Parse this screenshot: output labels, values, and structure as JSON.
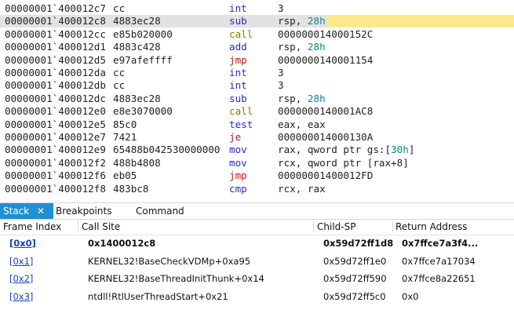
{
  "disassembly": [
    {
      "addr": "00000001`400012c7",
      "bytes": "cc",
      "mnemonic": "int",
      "operand": "3"
    },
    {
      "addr": "00000001`400012c8",
      "bytes": "4883ec28",
      "mnemonic": "sub",
      "operand": "rsp, ",
      "operand_hex": "28h",
      "current": true
    },
    {
      "addr": "00000001`400012cc",
      "bytes": "e85b020000",
      "mnemonic": "call",
      "operand": "000000014000152C"
    },
    {
      "addr": "00000001`400012d1",
      "bytes": "4883c428",
      "mnemonic": "add",
      "operand": "rsp, ",
      "operand_hex": "28h"
    },
    {
      "addr": "00000001`400012d5",
      "bytes": "e97afeffff",
      "mnemonic": "jmp",
      "operand": "0000000140001154"
    },
    {
      "addr": "00000001`400012da",
      "bytes": "cc",
      "mnemonic": "int",
      "operand": "3"
    },
    {
      "addr": "00000001`400012db",
      "bytes": "cc",
      "mnemonic": "int",
      "operand": "3"
    },
    {
      "addr": "00000001`400012dc",
      "bytes": "4883ec28",
      "mnemonic": "sub",
      "operand": "rsp, ",
      "operand_hex": "28h"
    },
    {
      "addr": "00000001`400012e0",
      "bytes": "e8e3070000",
      "mnemonic": "call",
      "operand": "0000000140001AC8"
    },
    {
      "addr": "00000001`400012e5",
      "bytes": "85c0",
      "mnemonic": "test",
      "operand": "eax, eax"
    },
    {
      "addr": "00000001`400012e7",
      "bytes": "7421",
      "mnemonic": "je",
      "operand": "000000014000130A"
    },
    {
      "addr": "00000001`400012e9",
      "bytes": "65488b042530000000",
      "mnemonic": "mov",
      "operand": "rax, qword ptr gs:[",
      "operand_hex": "30h",
      "operand_tail": "]"
    },
    {
      "addr": "00000001`400012f2",
      "bytes": "488b4808",
      "mnemonic": "mov",
      "operand": "rcx, qword ptr [rax+8]"
    },
    {
      "addr": "00000001`400012f6",
      "bytes": "eb05",
      "mnemonic": "jmp",
      "operand": "00000001400012FD"
    },
    {
      "addr": "00000001`400012f8",
      "bytes": "483bc8",
      "mnemonic": "cmp",
      "operand": "rcx, rax"
    }
  ],
  "tabs": [
    "Stack",
    "Breakpoints",
    "Command"
  ],
  "close_glyph": "✕",
  "stack": {
    "columns": [
      "Frame Index",
      "Call Site",
      "Child-SP",
      "Return Address"
    ],
    "rows": [
      {
        "index": "[0x0]",
        "call_site": "0x1400012c8",
        "child_sp": "0x59d72ff1d8",
        "ret": "0x7ffce7a3f4..."
      },
      {
        "index": "[0x1]",
        "call_site": "KERNEL32!BaseCheckVDMp+0xa95",
        "child_sp": "0x59d72ff1e0",
        "ret": "0x7ffce7a17034"
      },
      {
        "index": "[0x2]",
        "call_site": "KERNEL32!BaseThreadInitThunk+0x14",
        "child_sp": "0x59d72ff590",
        "ret": "0x7ffce8a22651"
      },
      {
        "index": "[0x3]",
        "call_site": "ntdll!RtlUserThreadStart+0x21",
        "child_sp": "0x59d72ff5c0",
        "ret": "0x0"
      }
    ]
  }
}
